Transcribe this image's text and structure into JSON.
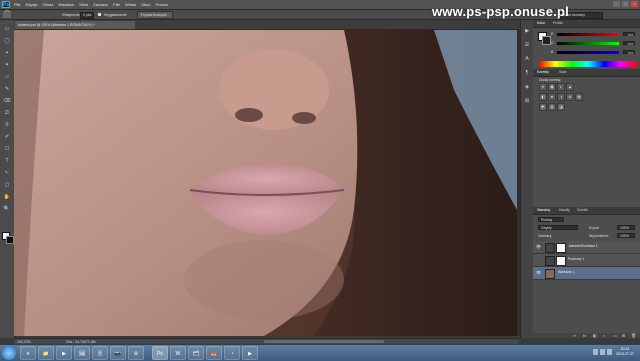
{
  "app": {
    "logo": "Ps"
  },
  "menu": [
    "Plik",
    "Edycja",
    "Obraz",
    "Warstwa",
    "Tekst",
    "Zaznacz",
    "Filtr",
    "Widok",
    "Okno",
    "Pomoc"
  ],
  "window_controls": [
    "–",
    "□",
    "×"
  ],
  "watermark": "www.ps-psp.onuse.pl",
  "options": {
    "feather_label": "Wtapianie:",
    "feather_value": "0 pks",
    "antialias_label": "Wygładzanie",
    "refine_button": "Popraw krawędź...",
    "workspace": "Układ domowy"
  },
  "document": {
    "tab_title": "kobieta.psd @ 150% (Warstwa 1,RGB/8/CMYK) *",
    "zoom": "150,33%",
    "doc_size": "Dok.: 34,7M/70,9M"
  },
  "tools": [
    "▭",
    "◯",
    "⌖",
    "✦",
    "▱",
    "✎",
    "⌫",
    "⎚",
    "⚲",
    "✐",
    "☐",
    "T",
    "↖",
    "▢",
    "✋",
    "🔍"
  ],
  "icon_strip": [
    "▶",
    "☰",
    "A",
    "¶",
    "◈",
    "⊞"
  ],
  "color_panel": {
    "tabs": [
      "Kolor",
      "Próbki"
    ],
    "sliders": [
      {
        "label": "R",
        "value": "224",
        "gradient": "#ff0000"
      },
      {
        "label": "G",
        "value": "224",
        "gradient": "#00ff00"
      },
      {
        "label": "B",
        "value": "224",
        "gradient": "#0000ff"
      }
    ]
  },
  "adjustments_panel": {
    "tabs": [
      "Korekty",
      "Style"
    ],
    "title": "Dodaj korektę",
    "icons": [
      "☀",
      "▦",
      "◐",
      "▲",
      "◧",
      "≋",
      "◑",
      "⚖",
      "▤",
      "◩",
      "▧",
      "◪"
    ]
  },
  "layers_panel": {
    "tabs": [
      "Warstwy",
      "Kanały",
      "Ścieżki"
    ],
    "kind_filter": "Rodzaj",
    "blend_mode": "Zwykły",
    "opacity_label": "Krycie:",
    "opacity_value": "100%",
    "lock_label": "Zablokuj:",
    "fill_label": "Wypełnienie:",
    "fill_value": "100%",
    "layers": [
      {
        "name": "Jasność/Kontrast 1",
        "visible_icon": "👁",
        "selected": false
      },
      {
        "name": "Poziomy 1",
        "visible_icon": "",
        "selected": false
      },
      {
        "name": "Warstwa 1",
        "visible_icon": "👁",
        "selected": true
      }
    ],
    "bottom_icons": [
      "∞",
      "fx",
      "◧",
      "◐",
      "▭",
      "⊞",
      "🗑"
    ]
  },
  "taskbar": {
    "apps": [
      "e",
      "📁",
      "▶",
      "🖼",
      "🗎",
      "📷",
      "⚙",
      "Ps",
      "W",
      "🗂",
      "🦊",
      "◔",
      "▶"
    ],
    "time": "20:31",
    "date": "2013-07-27"
  }
}
